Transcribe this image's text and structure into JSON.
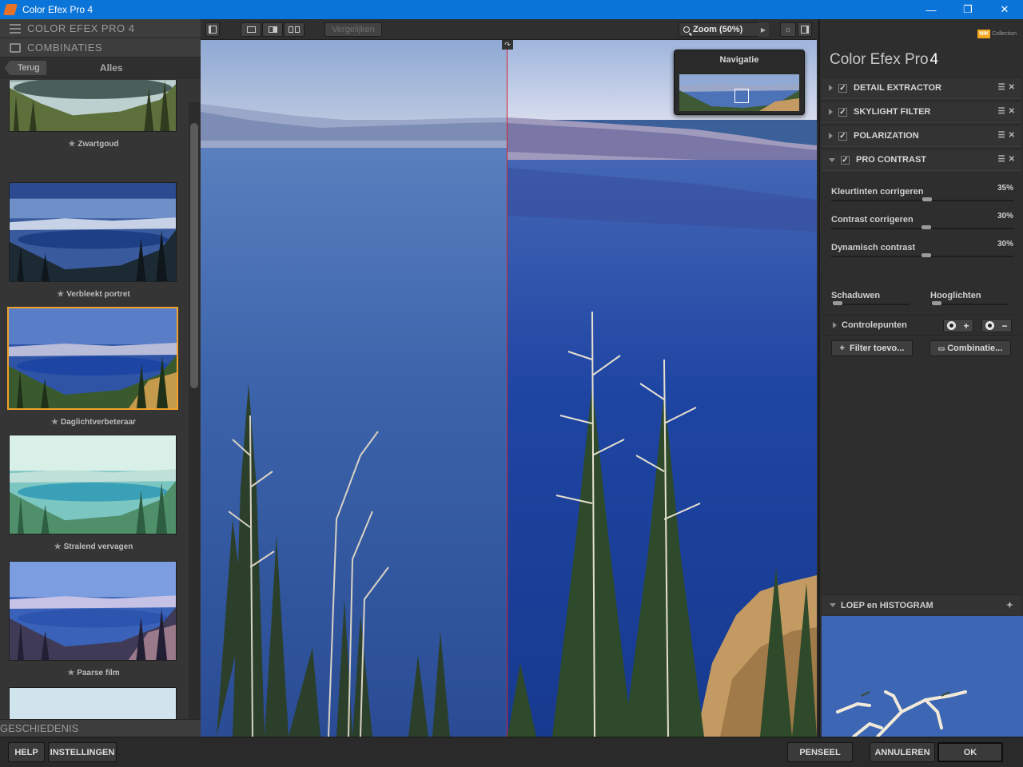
{
  "window": {
    "title": "Color Efex Pro 4",
    "controls": [
      "—",
      "❐",
      "✕"
    ]
  },
  "left_panel": {
    "header": "COLOR EFEX PRO 4",
    "section": "COMBINATIES",
    "back_label": "Terug",
    "filter_label": "Alles",
    "presets": [
      {
        "name": "Zwartgoud",
        "selected": false
      },
      {
        "name": "Verbleekt portret",
        "selected": false
      },
      {
        "name": "Daglichtverbeteraar",
        "selected": true
      },
      {
        "name": "Stralend vervagen",
        "selected": false
      },
      {
        "name": "Paarse film",
        "selected": false
      }
    ],
    "footer": "GESCHIEDENIS"
  },
  "toolbar": {
    "compare_label": "Vergelijken",
    "zoom_label": "Zoom (50%)"
  },
  "preview": {
    "navigator_title": "Navigatie"
  },
  "right_panel": {
    "brand_badge": "NIK",
    "brand_collection": "Collection",
    "title": "Color Efex Pro",
    "title_version": "4",
    "filters": [
      {
        "name": "DETAIL EXTRACTOR",
        "enabled": true,
        "expanded": false
      },
      {
        "name": "SKYLIGHT FILTER",
        "enabled": true,
        "expanded": false
      },
      {
        "name": "POLARIZATION",
        "enabled": true,
        "expanded": false
      },
      {
        "name": "PRO CONTRAST",
        "enabled": true,
        "expanded": true
      }
    ],
    "sliders": [
      {
        "label": "Kleurtinten corrigeren",
        "value_text": "35%",
        "value": 35
      },
      {
        "label": "Contrast corrigeren",
        "value_text": "30%",
        "value": 30
      },
      {
        "label": "Dynamisch contrast",
        "value_text": "30%",
        "value": 30
      }
    ],
    "shadows_label": "Schaduwen",
    "highlights_label": "Hooglichten",
    "controlpoints_label": "Controlepunten",
    "add_filter_label": "Filter toevo...",
    "combination_label": "Combinatie...",
    "loupe_label": "LOEP en HISTOGRAM"
  },
  "bottom": {
    "help": "HELP",
    "settings": "INSTELLINGEN",
    "brush": "PENSEEL",
    "cancel": "ANNULEREN",
    "ok": "OK"
  },
  "colors": {
    "accent_selected": "#f0a22b",
    "split_line": "#d4242c",
    "titlebar": "#0a74d8",
    "nik_badge": "#f7a51e"
  }
}
